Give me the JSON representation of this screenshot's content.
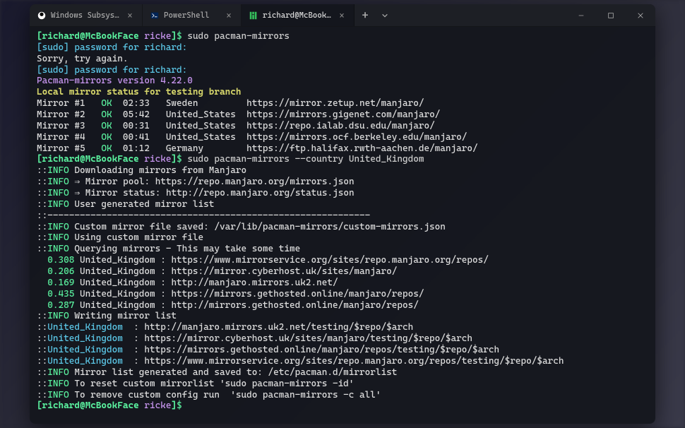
{
  "tabs": [
    {
      "label": "Windows Subsystem for Linux P",
      "icon": "tux"
    },
    {
      "label": "PowerShell",
      "icon": "ps"
    },
    {
      "label": "richard@McBookFace:/mnt/c/U",
      "icon": "manjaro",
      "active": true
    }
  ],
  "prompt": {
    "user_host": "richard@McBookFace",
    "cwd": "ricke",
    "open": "[",
    "close": "]",
    "dollar": "$"
  },
  "cmd1": " sudo pacman-mirrors",
  "sudo1": "[sudo] password for richard:",
  "sorry": "Sorry, try again.",
  "sudo2": "[sudo] password for richard:",
  "version": "Pacman-mirrors version 4.22.0",
  "status_header": "Local mirror status for testing branch",
  "mirrors": [
    {
      "n": "Mirror #1",
      "ok": "OK",
      "time": "02:33",
      "country": "Sweden",
      "url": "https://mirror.zetup.net/manjaro/"
    },
    {
      "n": "Mirror #2",
      "ok": "OK",
      "time": "05:42",
      "country": "United_States",
      "url": "https://mirrors.gigenet.com/manjaro/"
    },
    {
      "n": "Mirror #3",
      "ok": "OK",
      "time": "00:31",
      "country": "United_States",
      "url": "https://repo.ialab.dsu.edu/manjaro/"
    },
    {
      "n": "Mirror #4",
      "ok": "OK",
      "time": "00:41",
      "country": "United_States",
      "url": "https://mirrors.ocf.berkeley.edu/manjaro/"
    },
    {
      "n": "Mirror #5",
      "ok": "OK",
      "time": "01:12",
      "country": "Germany",
      "url": "https://ftp.halifax.rwth-aachen.de/manjaro/"
    }
  ],
  "cmd2": " sudo pacman-mirrors --country United_Kingdom",
  "info": {
    "pre": "::",
    "tag": "INFO",
    "dl": " Downloading mirrors from Manjaro",
    "pool": " ⇒ Mirror pool: https://repo.manjaro.org/mirrors.json",
    "status": " ⇒ Mirror status: http://repo.manjaro.org/status.json",
    "userlist": " User generated mirror list",
    "sep": "::------------------------------------------------------------",
    "custom_saved": " Custom mirror file saved: /var/lib/pacman-mirrors/custom-mirrors.json",
    "using_custom": " Using custom mirror file",
    "querying": " Querying mirrors - This may take some time",
    "writing": " Writing mirror list",
    "generated": " Mirror list generated and saved to: /etc/pacman.d/mirrorlist",
    "reset": " To reset custom mirrorlist 'sudo pacman-mirrors -id'",
    "remove": " To remove custom config run  'sudo pacman-mirrors -c all'"
  },
  "query_results": [
    {
      "t": "0.308",
      "c": "United_Kingdom",
      "u": "https://www.mirrorservice.org/sites/repo.manjaro.org/repos/"
    },
    {
      "t": "0.206",
      "c": "United_Kingdom",
      "u": "https://mirror.cyberhost.uk/sites/manjaro/"
    },
    {
      "t": "0.169",
      "c": "United_Kingdom",
      "u": "http://manjaro.mirrors.uk2.net/"
    },
    {
      "t": "0.435",
      "c": "United_Kingdom",
      "u": "https://mirrors.gethosted.online/manjaro/repos/"
    },
    {
      "t": "0.287",
      "c": "United_Kingdom",
      "u": "http://mirrors.gethosted.online/manjaro/repos/"
    }
  ],
  "written": [
    {
      "c": "United_Kingdom",
      "u": "http://manjaro.mirrors.uk2.net/testing/$repo/$arch"
    },
    {
      "c": "United_Kingdom",
      "u": "https://mirror.cyberhost.uk/sites/manjaro/testing/$repo/$arch"
    },
    {
      "c": "United_Kingdom",
      "u": "https://mirrors.gethosted.online/manjaro/repos/testing/$repo/$arch"
    },
    {
      "c": "United_Kingdom",
      "u": "https://www.mirrorservice.org/sites/repo.manjaro.org/repos/testing/$repo/$arch"
    }
  ]
}
